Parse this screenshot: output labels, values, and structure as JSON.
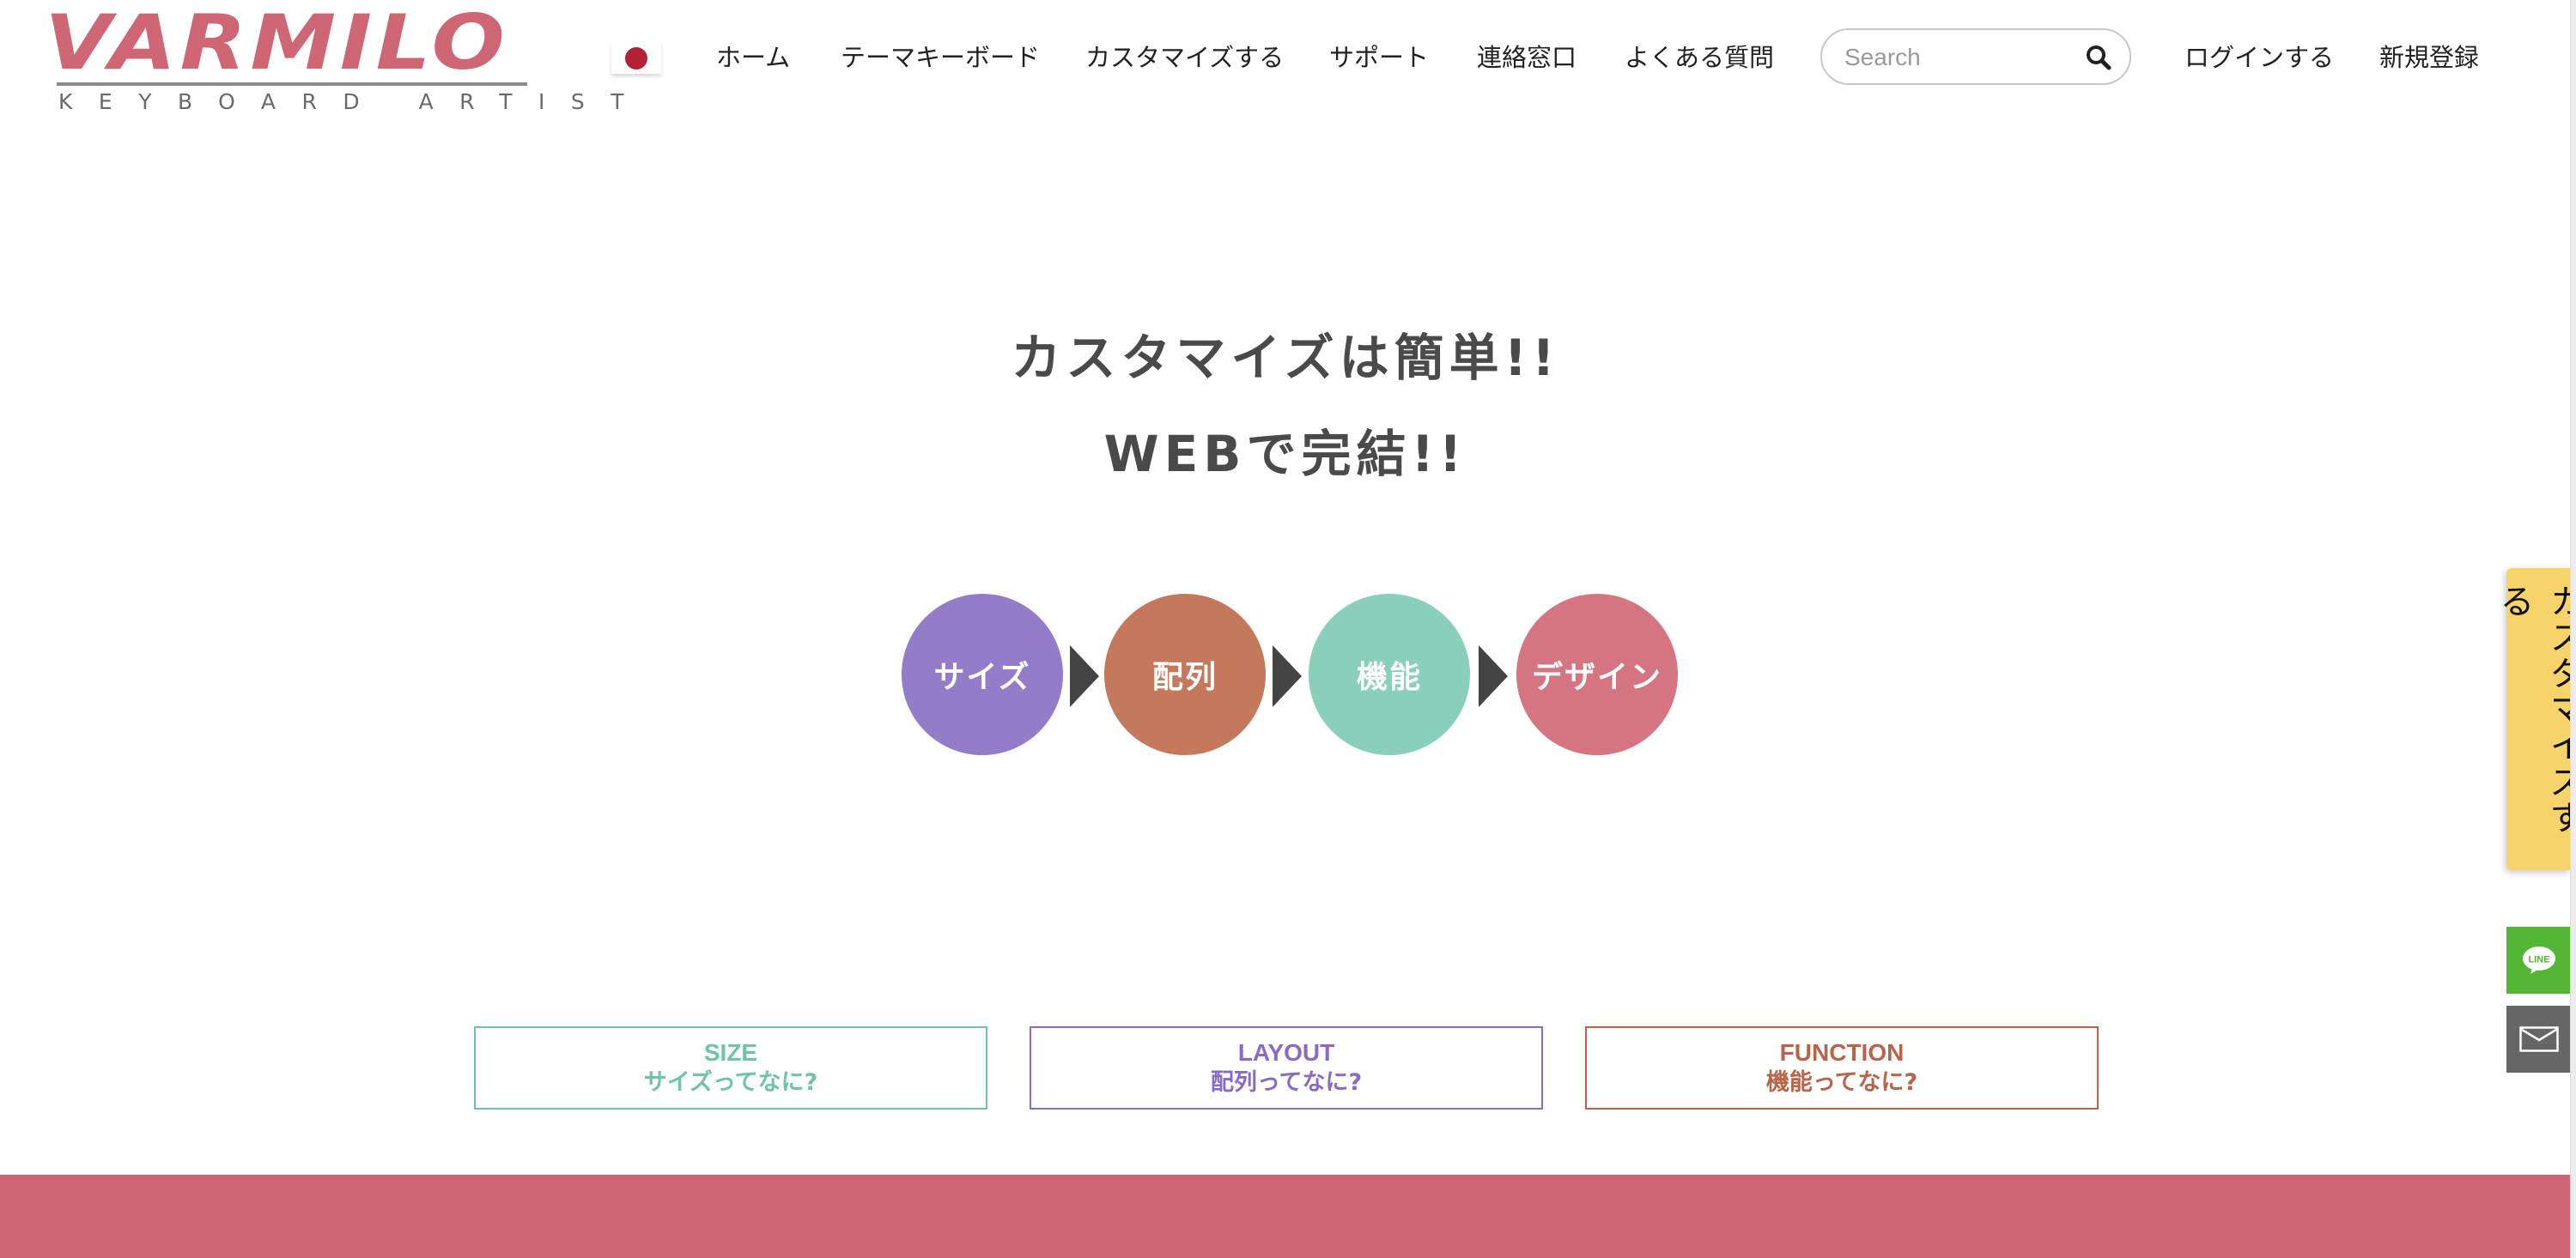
{
  "brand": {
    "name": "VARMILO",
    "tagline": "KEYBOARD ARTIST",
    "color": "#cf6673"
  },
  "language": {
    "current": "Japanese",
    "flag_icon": "japan-flag-icon"
  },
  "nav": {
    "items": [
      {
        "label": "ホーム"
      },
      {
        "label": "テーマキーボード"
      },
      {
        "label": "カスタマイズする"
      },
      {
        "label": "サポート"
      },
      {
        "label": "連絡窓口"
      },
      {
        "label": "よくある質問"
      }
    ],
    "search": {
      "placeholder": "Search",
      "value": "",
      "icon": "search-icon"
    },
    "login_label": "ログインする",
    "register_label": "新規登録"
  },
  "hero": {
    "line1": "カスタマイズは簡単!!",
    "line2": "WEBで完結!!"
  },
  "steps": [
    {
      "label": "サイズ",
      "color": "#957cc9"
    },
    {
      "label": "配列",
      "color": "#c4795c"
    },
    {
      "label": "機能",
      "color": "#8acfba"
    },
    {
      "label": "デザイン",
      "color": "#d47581"
    }
  ],
  "info_boxes": [
    {
      "title": "SIZE",
      "subtitle": "サイズってなに?",
      "color": "#6fc3a6"
    },
    {
      "title": "LAYOUT",
      "subtitle": "配列ってなに?",
      "color": "#8a6bc4"
    },
    {
      "title": "FUNCTION",
      "subtitle": "機能ってなに?",
      "color": "#b8644a"
    }
  ],
  "side_tabs": {
    "customize_label": "カスタマイズする",
    "customize_color": "#f7d46b",
    "line_label": "LINE",
    "line_color": "#52b534",
    "mail_icon": "mail-icon",
    "mail_color": "#666666"
  },
  "footer_banner_color": "#cc6673"
}
